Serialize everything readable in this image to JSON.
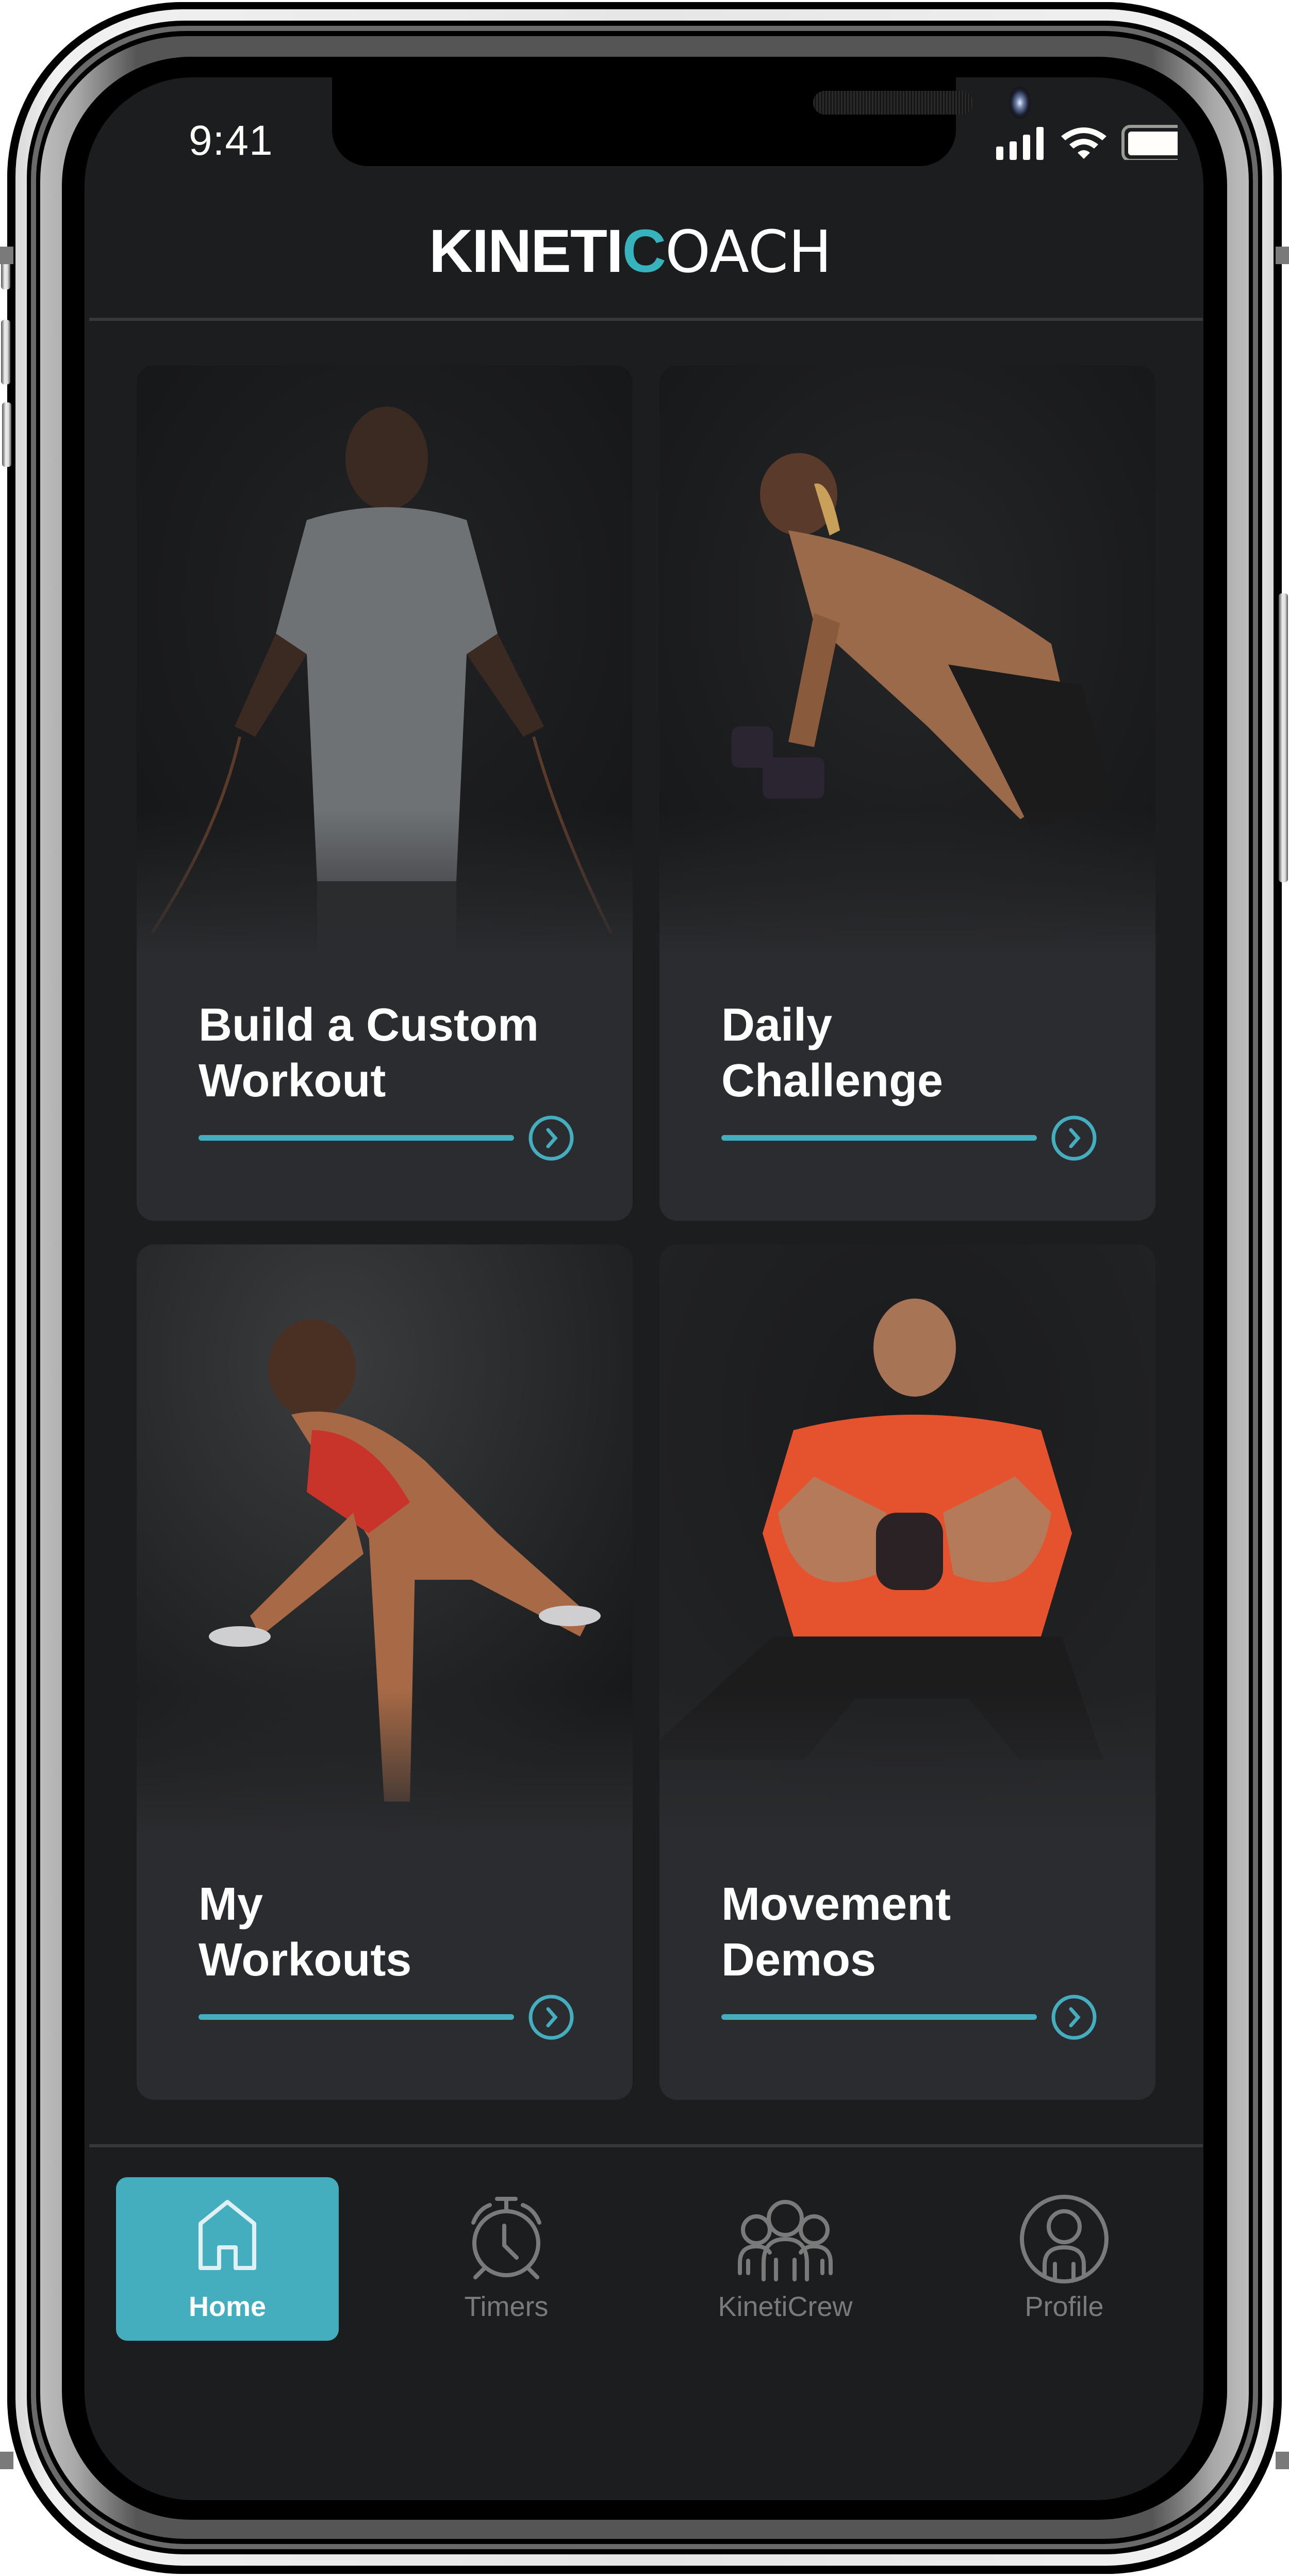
{
  "colors": {
    "accent": "#44adbe",
    "logo_accent": "#36b3bc",
    "screen_bg": "#1c1d1f",
    "card_bg": "#2b2c2f",
    "tab_inactive": "#7a7a7a",
    "tab_active_text": "#ffffff",
    "icon_active": "#dff1f4"
  },
  "status_bar": {
    "time": "9:41",
    "signal_icon": "cellular-signal-icon",
    "wifi_icon": "wifi-icon",
    "battery_icon": "battery-full-icon",
    "battery_level": 1.0
  },
  "header": {
    "logo_bold": "KINETI",
    "logo_accent": "C",
    "logo_thin": "OACH"
  },
  "cards": [
    {
      "title": "Build a Custom\nWorkout",
      "icon": "chevron-right-circle-icon",
      "photo": "man-with-jump-rope"
    },
    {
      "title": "Daily\nChallenge",
      "icon": "chevron-right-circle-icon",
      "photo": "woman-dumbbell-row"
    },
    {
      "title": "My\nWorkouts",
      "icon": "chevron-right-circle-icon",
      "photo": "woman-plank-reach"
    },
    {
      "title": "Movement\nDemos",
      "icon": "chevron-right-circle-icon",
      "photo": "man-kettlebell-squat"
    }
  ],
  "tab_bar": {
    "active": "Home",
    "tabs": [
      {
        "label": "Home",
        "icon": "home-icon"
      },
      {
        "label": "Timers",
        "icon": "alarm-clock-icon"
      },
      {
        "label": "KinetiCrew",
        "icon": "group-icon"
      },
      {
        "label": "Profile",
        "icon": "profile-icon"
      }
    ]
  }
}
